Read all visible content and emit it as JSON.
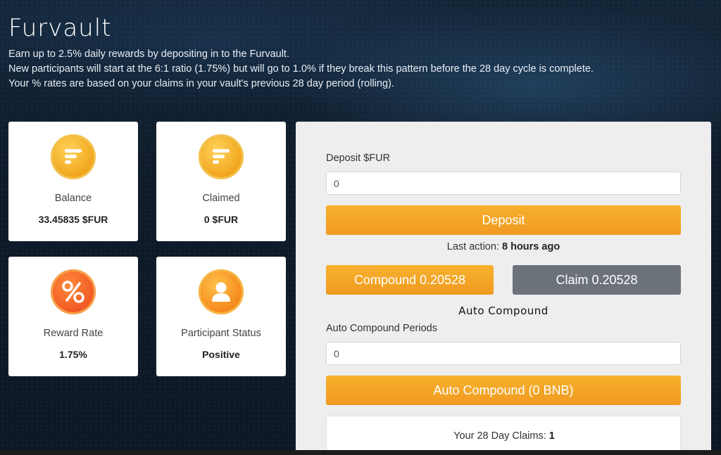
{
  "app": {
    "logo_text": "Furvault"
  },
  "intro": {
    "line1": "Earn up to 2.5% daily rewards by depositing in to the Furvault.",
    "line2": "New participants will start at the 6:1 ratio (1.75%) but will go to 1.0% if they break this pattern before the 28 day cycle is complete.",
    "line3": "Your % rates are based on your claims in your vault's previous 28 day period (rolling)."
  },
  "stats": {
    "balance": {
      "label": "Balance",
      "value": "33.45835 $FUR",
      "icon": "furfi-coin-icon"
    },
    "claimed": {
      "label": "Claimed",
      "value": "0 $FUR",
      "icon": "furfi-coin-icon"
    },
    "reward_rate": {
      "label": "Reward Rate",
      "value": "1.75%",
      "icon": "percent-icon"
    },
    "participant_status": {
      "label": "Participant Status",
      "value": "Positive",
      "icon": "user-icon"
    }
  },
  "deposit": {
    "label": "Deposit $FUR",
    "input_value": "0",
    "button_label": "Deposit"
  },
  "last_action": {
    "prefix": "Last action:",
    "value": "8 hours ago"
  },
  "actions": {
    "compound_label": "Compound 0.20528",
    "claim_label": "Claim 0.20528"
  },
  "auto_compound": {
    "title": "Auto Compound",
    "periods_label": "Auto Compound Periods",
    "periods_value": "0",
    "button_label": "Auto Compound (0 BNB)"
  },
  "claims": {
    "prefix": "Your 28 Day Claims:",
    "value": "1"
  },
  "colors": {
    "background": "#0f1a28",
    "accent_orange": "#f09a20",
    "claim_gray": "#6c727a",
    "card_white": "#ffffff"
  }
}
